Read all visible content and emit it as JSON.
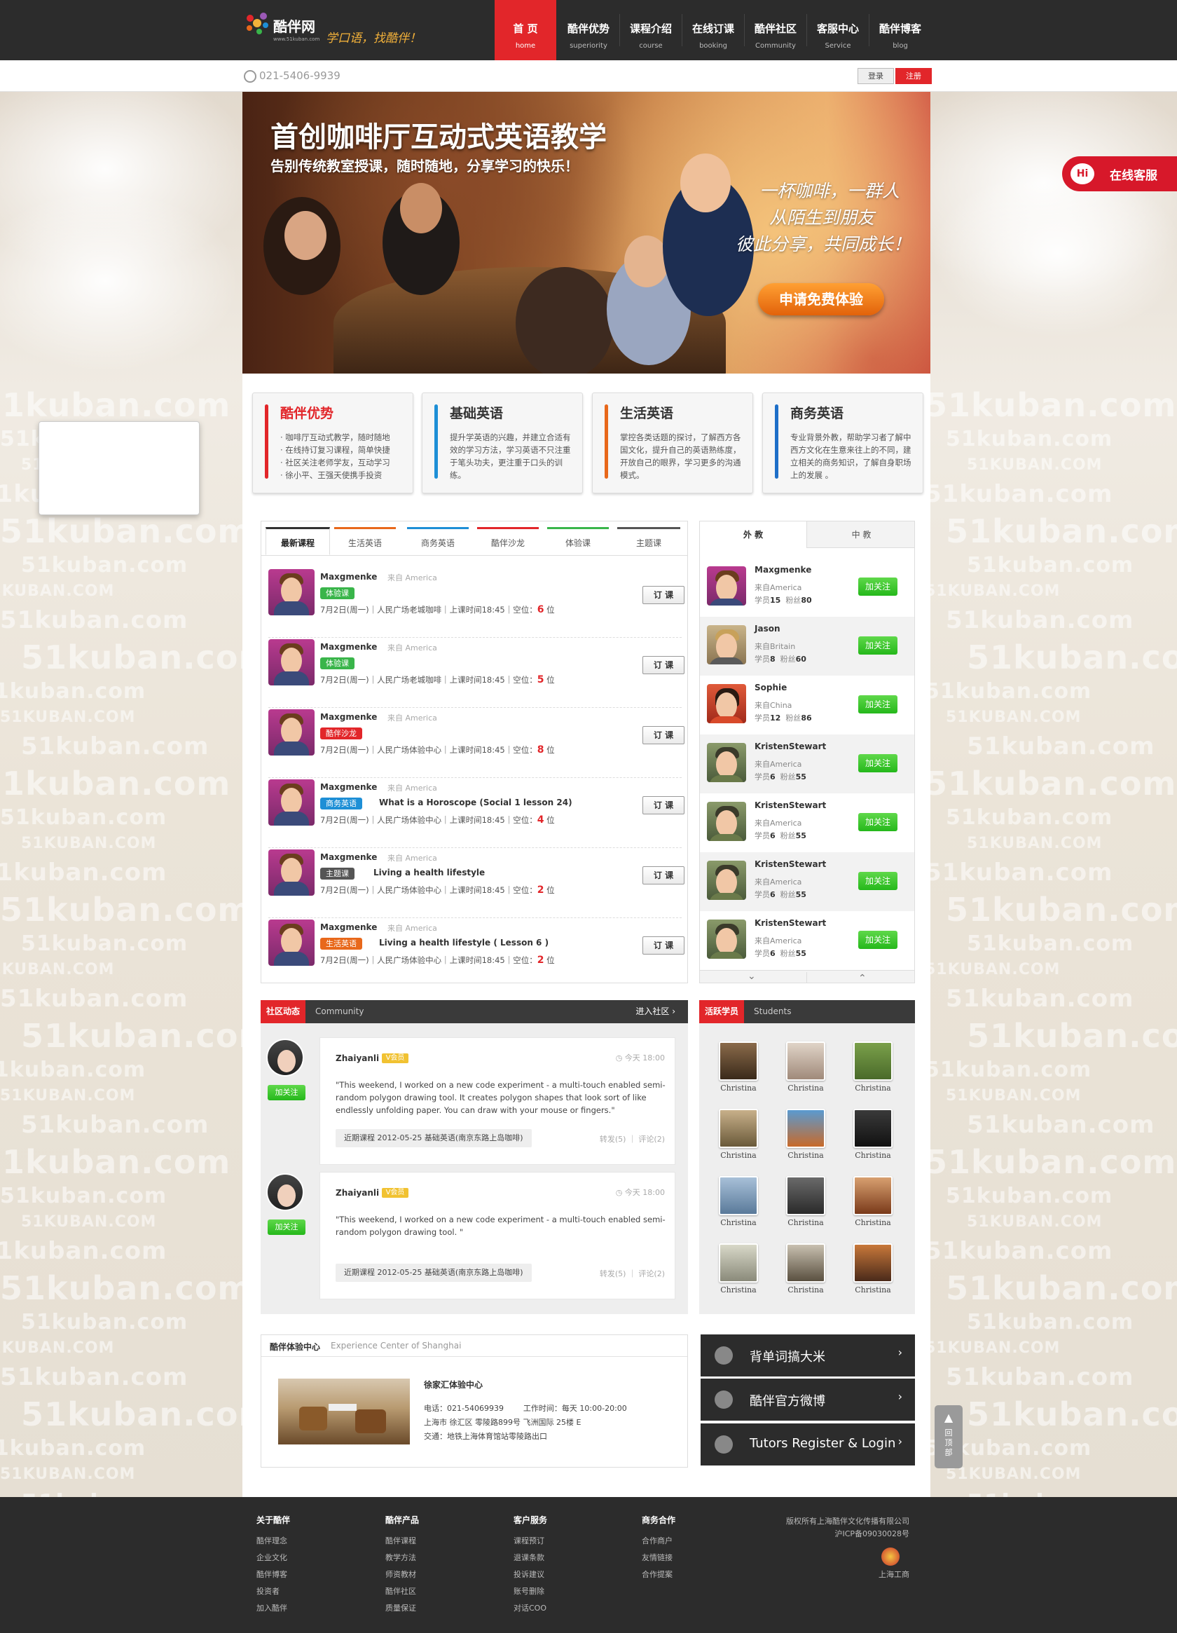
{
  "header": {
    "logo_text": "酷伴网",
    "logo_url": "www.51kuban.com",
    "slogan": "学口语，找酷伴！",
    "nav": [
      {
        "cn": "首 页",
        "en": "home",
        "active": true
      },
      {
        "cn": "酷伴优势",
        "en": "superiority"
      },
      {
        "cn": "课程介绍",
        "en": "course"
      },
      {
        "cn": "在线订课",
        "en": "booking"
      },
      {
        "cn": "酷伴社区",
        "en": "Community"
      },
      {
        "cn": "客服中心",
        "en": "Service"
      },
      {
        "cn": "酷伴博客",
        "en": "blog"
      }
    ],
    "phone": "021-5406-9939",
    "login": "登录",
    "register": "注册"
  },
  "banner": {
    "title": "首创咖啡厅互动式英语教学",
    "subtitle": "告别传统教室授课，随时随地，分享学习的快乐！",
    "line1": "一杯咖啡，一群人",
    "line2": "从陌生到朋友",
    "line3": "彼此分享，共同成长！",
    "cta": "申请免费体验"
  },
  "online_service": {
    "hi": "Hi",
    "label": "在线客服"
  },
  "features": [
    {
      "title": "酷伴优势",
      "color": "#e2262a",
      "desc": "· 咖啡厅互动式教学，随时随地\n· 在线持订复习课程，简单快捷\n· 社区关注老师学友，互动学习\n· 徐小平、王强天使携手投资"
    },
    {
      "title": "基础英语",
      "color": "#1e8fd6",
      "desc": "提升学英语的兴趣，并建立合适有效的学习方法，学习英语不只注重于笔头功夫，更注重于口头的训练。"
    },
    {
      "title": "生活英语",
      "color": "#e8681b",
      "desc": "掌控各类话题的探讨，了解西方各国文化，提升自己的英语熟练度，开放自己的眼界，学习更多的沟通模式。"
    },
    {
      "title": "商务英语",
      "color": "#1e6fc8",
      "desc": "专业背景外教，帮助学习者了解中西方文化在生意来往上的不同，建立相关的商务知识，了解自身职场上的发展 。"
    }
  ],
  "courses": {
    "tabs": [
      {
        "label": "最新课程",
        "color": "#333"
      },
      {
        "label": "生活英语",
        "color": "#e8681b"
      },
      {
        "label": "商务英语",
        "color": "#1e8fd6"
      },
      {
        "label": "酷伴沙龙",
        "color": "#e2262a"
      },
      {
        "label": "体验课",
        "color": "#39b54a"
      },
      {
        "label": "主题课",
        "color": "#555"
      }
    ],
    "rows": [
      {
        "name": "Maxgmenke",
        "from": "来自 America",
        "tag": "体验课",
        "tag_color": "#39b54a",
        "title": "",
        "info": "7月2日(周一)｜人民广场老城咖啡｜上课时间18:45｜空位：",
        "seats": "6",
        "unit": " 位",
        "book": "订 课"
      },
      {
        "name": "Maxgmenke",
        "from": "来自 America",
        "tag": "体验课",
        "tag_color": "#39b54a",
        "title": "",
        "info": "7月2日(周一)｜人民广场老城咖啡｜上课时间18:45｜空位：",
        "seats": "5",
        "unit": " 位",
        "book": "订 课"
      },
      {
        "name": "Maxgmenke",
        "from": "来自 America",
        "tag": "酷伴沙龙",
        "tag_color": "#e2262a",
        "title": "",
        "info": "7月2日(周一)｜人民广场体验中心｜上课时间18:45｜空位：",
        "seats": "8",
        "unit": " 位",
        "book": "订 课"
      },
      {
        "name": "Maxgmenke",
        "from": "来自 America",
        "tag": "商务英语",
        "tag_color": "#1e8fd6",
        "title": "What is a Horoscope (Social 1 lesson 24)",
        "info": "7月2日(周一)｜人民广场体验中心｜上课时间18:45｜空位：",
        "seats": "4",
        "unit": " 位",
        "book": "订 课"
      },
      {
        "name": "Maxgmenke",
        "from": "来自 America",
        "tag": "主题课",
        "tag_color": "#555",
        "title": "Living a health lifestyle",
        "info": "7月2日(周一)｜人民广场体验中心｜上课时间18:45｜空位：",
        "seats": "2",
        "unit": " 位",
        "book": "订 课"
      },
      {
        "name": "Maxgmenke",
        "from": "来自 America",
        "tag": "生活英语",
        "tag_color": "#e8681b",
        "title": "Living a health lifestyle ( Lesson 6 )",
        "info": "7月2日(周一)｜人民广场体验中心｜上课时间18:45｜空位：",
        "seats": "2",
        "unit": " 位",
        "book": "订 课"
      }
    ]
  },
  "teachers": {
    "tabs": [
      "外 教",
      "中 教"
    ],
    "rows": [
      {
        "name": "Maxgmenke",
        "from": "来自America",
        "students_label": "学员",
        "students": "15",
        "fans_label": "粉丝",
        "fans": "80",
        "follow": "加关注"
      },
      {
        "name": "Jason",
        "from": "来自Britain",
        "students_label": "学员",
        "students": "8",
        "fans_label": "粉丝",
        "fans": "60",
        "follow": "加关注"
      },
      {
        "name": "Sophie",
        "from": "来自China",
        "students_label": "学员",
        "students": "12",
        "fans_label": "粉丝",
        "fans": "86",
        "follow": "加关注"
      },
      {
        "name": "KristenStewart",
        "from": "来自America",
        "students_label": "学员",
        "students": "6",
        "fans_label": "粉丝",
        "fans": "55",
        "follow": "加关注"
      },
      {
        "name": "KristenStewart",
        "from": "来自America",
        "students_label": "学员",
        "students": "6",
        "fans_label": "粉丝",
        "fans": "55",
        "follow": "加关注"
      },
      {
        "name": "KristenStewart",
        "from": "来自America",
        "students_label": "学员",
        "students": "6",
        "fans_label": "粉丝",
        "fans": "55",
        "follow": "加关注"
      },
      {
        "name": "KristenStewart",
        "from": "来自America",
        "students_label": "学员",
        "students": "6",
        "fans_label": "粉丝",
        "fans": "55",
        "follow": "加关注"
      }
    ],
    "down": "⌄",
    "up": "⌃"
  },
  "community": {
    "head_cn": "社区动态",
    "head_en": "Community",
    "enter": "进入社区 ›",
    "posts": [
      {
        "name": "Zhaiyanli",
        "vip": "V会员",
        "time": "今天 18:00",
        "follow": "加关注",
        "text": "\"This weekend, I worked on a new code experiment - a multi-touch enabled semi-random polygon drawing tool. It creates polygon shapes that look sort of like endlessly unfolding paper. You can draw with your mouse or fingers.\"",
        "course": "近期课程  2012-05-25    基础英语(南京东路上岛咖啡)",
        "actions": "转发(5)  ｜  评论(2)"
      },
      {
        "name": "Zhaiyanli",
        "vip": "V会员",
        "time": "今天 18:00",
        "follow": "加关注",
        "text": "\"This weekend, I worked on a new code experiment - a multi-touch enabled semi-random polygon drawing tool. \"",
        "course": "近期课程  2012-05-25    基础英语(南京东路上岛咖啡)",
        "actions": "转发(5)  ｜  评论(2)"
      }
    ]
  },
  "students": {
    "head_cn": "活跃学员",
    "head_en": "Students",
    "names": [
      "Christina",
      "Christina",
      "Christina",
      "Christina",
      "Christina",
      "Christina",
      "Christina",
      "Christina",
      "Christina",
      "Christina",
      "Christina",
      "Christina"
    ]
  },
  "experience": {
    "head_cn": "酷伴体验中心",
    "head_en": "Experience Center of Shanghai",
    "name": "徐家汇体验中心",
    "phone": "电话：021-54069939        工作时间：每天 10:00-20:00",
    "address": "上海市 徐汇区  零陵路899号  飞洲国际 25楼 E",
    "traffic": "交通：地铁上海体育馆站零陵路出口"
  },
  "quick_links": [
    {
      "label": "背单词搞大米",
      "icon": "clock-icon"
    },
    {
      "label": "酷伴官方微博",
      "icon": "weibo-icon"
    },
    {
      "label": "Tutors Register & Login",
      "icon": "users-icon"
    }
  ],
  "back_to_top": "回顶部",
  "footer": {
    "cols": [
      {
        "title": "关于酷伴",
        "items": [
          "酷伴理念",
          "企业文化",
          "酷伴博客",
          "投资者",
          "加入酷伴"
        ]
      },
      {
        "title": "酷伴产品",
        "items": [
          "酷伴课程",
          "教学方法",
          "师资教材",
          "酷伴社区",
          "质量保证"
        ]
      },
      {
        "title": "客户服务",
        "items": [
          "课程预订",
          "退课条款",
          "投诉建议",
          "账号删除",
          "对话COO"
        ]
      },
      {
        "title": "商务合作",
        "items": [
          "合作商户",
          "友情链接",
          "合作提案"
        ]
      }
    ],
    "copyright": "版权所有上海酷伴文化传播有限公司",
    "icp": "沪ICP备09030028号",
    "badge": "上海工商"
  }
}
